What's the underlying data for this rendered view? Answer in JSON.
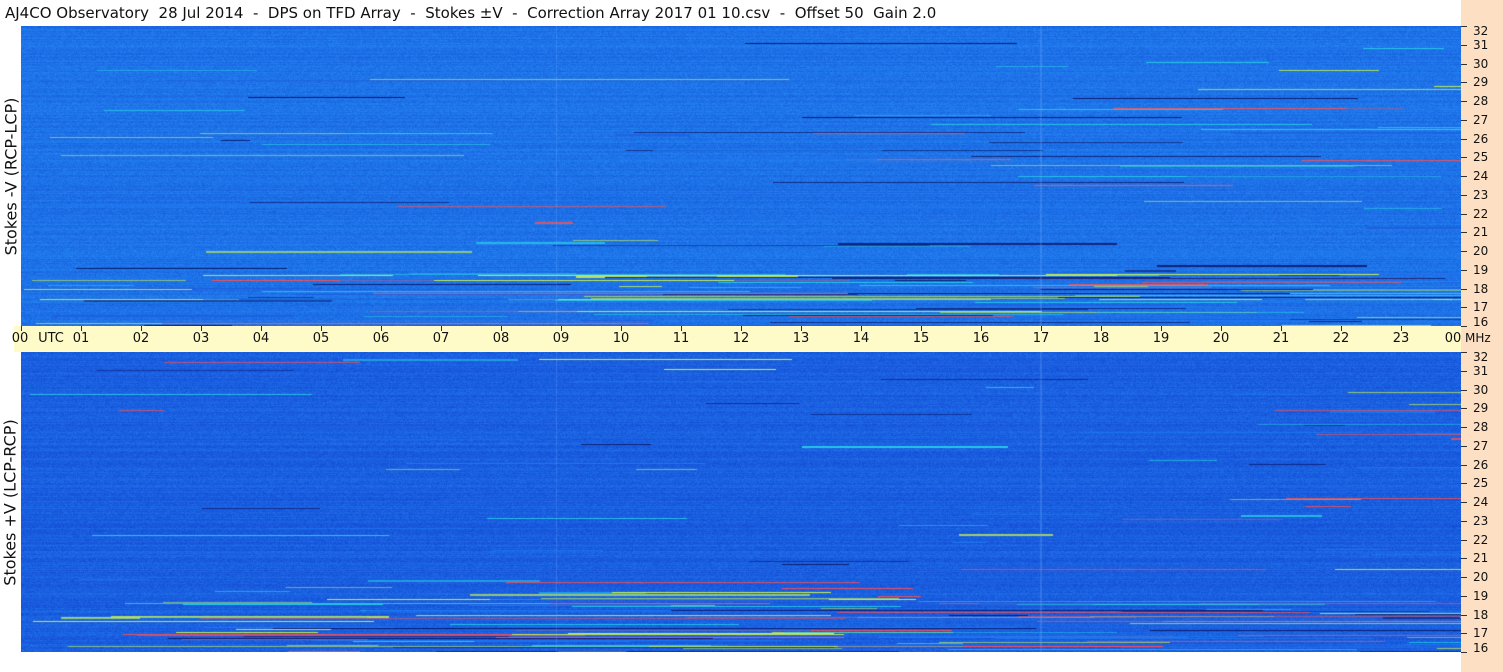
{
  "title": "AJ4CO Observatory  28 Jul 2014  -  DPS on TFD Array  -  Stokes ±V  -  Correction Array 2017 01 10.csv  -  Offset 50  Gain 2.0",
  "chart_data": {
    "type": "heatmap",
    "time_axis": {
      "labels": [
        "00",
        "UTC",
        "01",
        "02",
        "03",
        "04",
        "05",
        "06",
        "07",
        "08",
        "09",
        "10",
        "11",
        "12",
        "13",
        "14",
        "15",
        "16",
        "17",
        "18",
        "19",
        "20",
        "21",
        "22",
        "23",
        "00"
      ],
      "range_hours": [
        0,
        24
      ]
    },
    "freq_axis": {
      "unit_label": "MHz",
      "ticks": [
        32,
        31,
        30,
        29,
        28,
        27,
        26,
        25,
        24,
        23,
        22,
        21,
        20,
        19,
        18,
        17,
        16
      ],
      "range_mhz": [
        16,
        32
      ]
    },
    "panels": [
      {
        "label": "Stokes -V (RCP-LCP)",
        "base_color": "#1e72e8"
      },
      {
        "label": "Stokes +V (LCP-RCP)",
        "base_color": "#1a5fe0"
      }
    ],
    "colormap": [
      "#0a1a6e",
      "#1e5fe0",
      "#1e78f0",
      "#28c8e8",
      "#c8f050",
      "#ff5050"
    ]
  }
}
